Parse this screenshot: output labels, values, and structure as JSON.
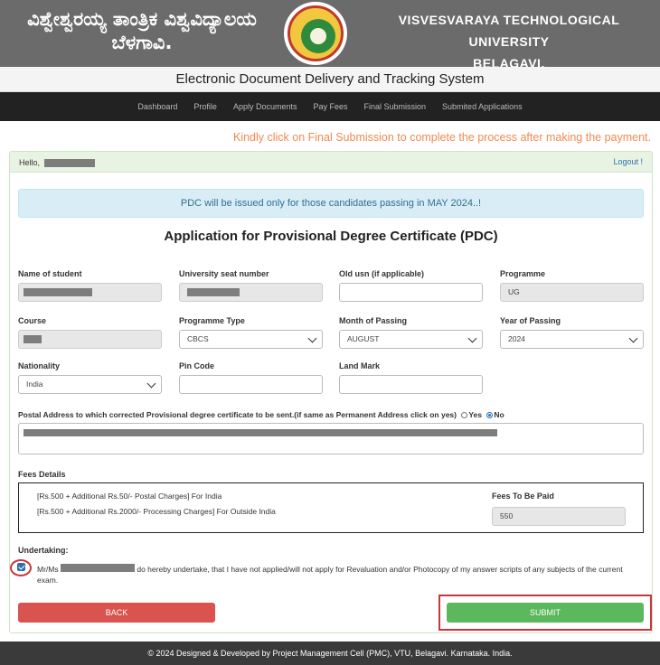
{
  "header": {
    "kannada_title_line1": "ವಿಶ್ವೇಶ್ವರಯ್ಯ ತಾಂತ್ರಿಕ ವಿಶ್ವವಿದ್ಯಾಲಯ",
    "kannada_title_line2": "ಬೆಳಗಾವಿ.",
    "english_title_line1": "VISVESVARAYA TECHNOLOGICAL UNIVERSITY",
    "english_title_line2": "BELAGAVI.",
    "system_title": "Electronic Document Delivery and Tracking System"
  },
  "nav": {
    "items": [
      "Dashboard",
      "Profile",
      "Apply Documents",
      "Pay Fees",
      "Final Submission",
      "Submited Applications"
    ]
  },
  "notice": "Kindly click on Final Submission to complete the process after making the payment.",
  "panel": {
    "hello": "Hello,",
    "logout": "Logout !"
  },
  "info_message": "PDC will be issued only for those candidates passing in MAY 2024..!",
  "form_title": "Application for Provisional Degree Certificate (PDC)",
  "fields": {
    "name_label": "Name of student",
    "usn_label": "University seat number",
    "old_usn_label": "Old usn (if applicable)",
    "programme_label": "Programme",
    "programme_value": "UG",
    "course_label": "Course",
    "programme_type_label": "Programme Type",
    "programme_type_value": "CBCS",
    "month_label": "Month of Passing",
    "month_value": "AUGUST",
    "year_label": "Year of Passing",
    "year_value": "2024",
    "nationality_label": "Nationality",
    "nationality_value": "India",
    "pincode_label": "Pin Code",
    "landmark_label": "Land Mark"
  },
  "postal": {
    "label": "Postal Address to which corrected Provisional degree certificate to be sent.(if same as Permanent Address click on yes)",
    "yes": "Yes",
    "no": "No",
    "selected": "No"
  },
  "fees": {
    "label": "Fees Details",
    "line1": "[Rs.500 + Additional Rs.50/- Postal Charges] For India",
    "line2": "[Rs.500 + Additional Rs.2000/- Processing Charges] For Outside India",
    "to_pay_label": "Fees To Be Paid",
    "to_pay_value": "550"
  },
  "undertaking": {
    "label": "Undertaking:",
    "prefix": "Mr/Ms",
    "text": "do hereby undertake, that I have not applied/will not apply for Revaluation and/or Photocopy of my answer scripts of any subjects of the current exam.",
    "checked": true
  },
  "buttons": {
    "back": "BACK",
    "submit": "SUBMIT"
  },
  "footer": "© 2024 Designed & Developed by Project Management Cell (PMC), VTU, Belagavi. Karnataka. India.",
  "colors": {
    "banner": "#6b6b6b",
    "navbar": "#222222",
    "notice": "#f08a50",
    "back_button": "#d9534f",
    "submit_button": "#5cb85c",
    "highlight": "#c9363e"
  }
}
